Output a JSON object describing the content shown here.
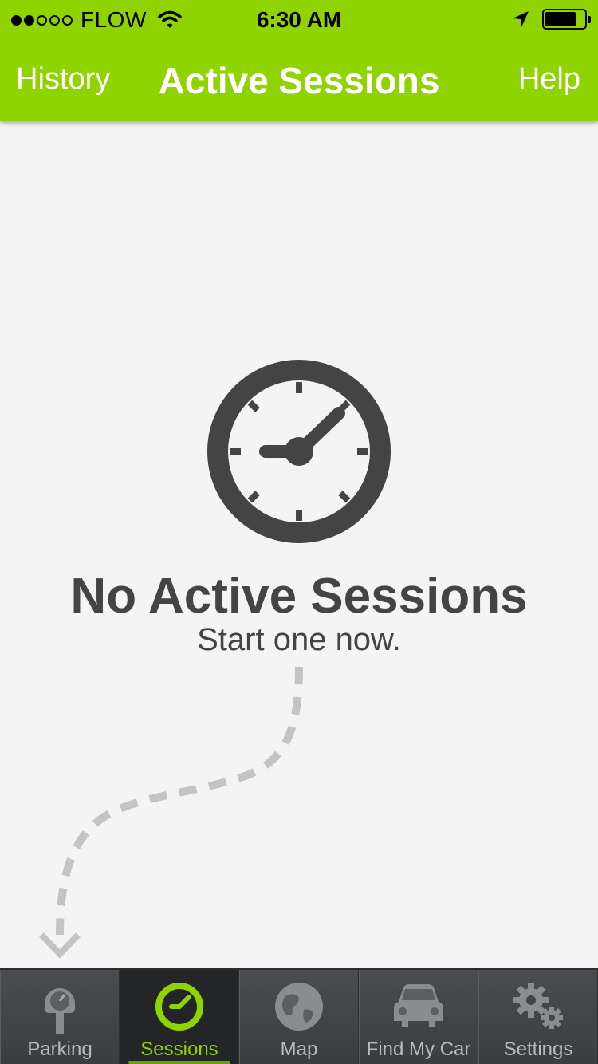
{
  "status_bar": {
    "carrier": "FLOW",
    "time": "6:30 AM",
    "signal_bars_filled": 2,
    "signal_bars_total": 5,
    "battery_level": 0.7
  },
  "header": {
    "left_label": "History",
    "title": "Active Sessions",
    "right_label": "Help"
  },
  "empty_state": {
    "title": "No Active Sessions",
    "subtitle": "Start one now."
  },
  "tabs": [
    {
      "label": "Parking",
      "icon": "parking-meter-icon",
      "active": false
    },
    {
      "label": "Sessions",
      "icon": "clock-icon",
      "active": true
    },
    {
      "label": "Map",
      "icon": "globe-icon",
      "active": false
    },
    {
      "label": "Find My Car",
      "icon": "car-icon",
      "active": false
    },
    {
      "label": "Settings",
      "icon": "gear-icon",
      "active": false
    }
  ],
  "colors": {
    "brand_green": "#8fd400",
    "text_dark": "#444444",
    "tab_bar": "#3b3d40"
  }
}
